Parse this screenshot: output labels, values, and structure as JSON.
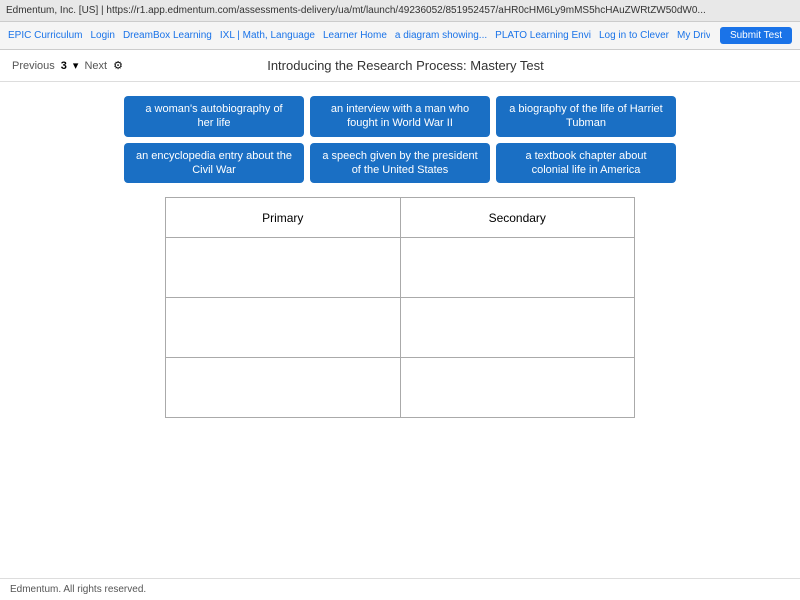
{
  "browser": {
    "bar_text": "Edmentum, Inc. [US] | https://r1.app.edmentum.com/assessments-delivery/ua/mt/launch/49236052/851952457/aHR0cHM6Ly9mMS5hcHAuZWRtZW50dW0...",
    "nav_links": [
      "EPIC Curriculum",
      "Login",
      "DreamBox Learning",
      "IXL | Math, Language",
      "Learner Home",
      "a diagram showing...",
      "PLATO Learning Envi",
      "Log in to Clever",
      "My Drive -"
    ],
    "submit_label": "Submit Test"
  },
  "page_nav": {
    "previous": "Previous",
    "page_num": "3",
    "next": "Next"
  },
  "page_title": "Introducing the Research Process: Mastery Test",
  "drag_items": [
    {
      "id": "item1",
      "text": "a woman's autobiography of her life"
    },
    {
      "id": "item2",
      "text": "an interview with a man who fought in World War II"
    },
    {
      "id": "item3",
      "text": "a biography of the life of Harriet Tubman"
    },
    {
      "id": "item4",
      "text": "an encyclopedia entry about the Civil War"
    },
    {
      "id": "item5",
      "text": "a speech given by the president of the United States"
    },
    {
      "id": "item6",
      "text": "a textbook chapter about colonial life in America"
    }
  ],
  "table": {
    "col1_header": "Primary",
    "col2_header": "Secondary",
    "rows": 3
  },
  "footer": {
    "text": "Edmentum. All rights reserved."
  }
}
